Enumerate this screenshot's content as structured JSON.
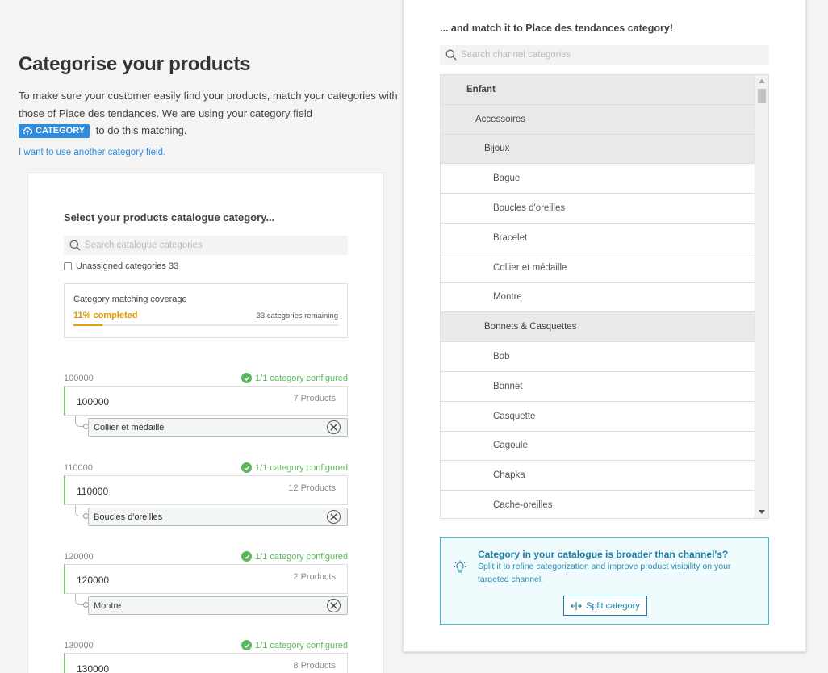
{
  "intro": {
    "title": "Categorise your products",
    "desc1": "To make sure your customer easily find your products, match your categories with those of Place des tendances. We are using your category field",
    "badge": "CATEGORY",
    "desc2": "to do this matching.",
    "link": "I want to use another category field."
  },
  "left": {
    "heading": "Select your products catalogue category...",
    "search_placeholder": "Search catalogue categories",
    "unassigned_label": "Unassigned categories 33",
    "coverage": {
      "label": "Category matching coverage",
      "completed": "11% completed",
      "remaining": "33 categories remaining",
      "percent": 11
    },
    "groups": [
      {
        "code": "100000",
        "status": "1/1 category configured",
        "name": "100000",
        "products": "7 Products",
        "match": "Collier et médaille"
      },
      {
        "code": "110000",
        "status": "1/1 category configured",
        "name": "110000",
        "products": "12 Products",
        "match": "Boucles d'oreilles"
      },
      {
        "code": "120000",
        "status": "1/1 category configured",
        "name": "120000",
        "products": "2 Products",
        "match": "Montre"
      },
      {
        "code": "130000",
        "status": "1/1 category configured",
        "name": "130000",
        "products": "8 Products",
        "match": ""
      }
    ]
  },
  "right": {
    "heading": "... and match it to Place des tendances category!",
    "search_placeholder": "Search channel categories",
    "tree": [
      {
        "label": "Enfant",
        "level": 0
      },
      {
        "label": "Accessoires",
        "level": 1
      },
      {
        "label": "Bijoux",
        "level": 2
      },
      {
        "label": "Bague",
        "level": 3
      },
      {
        "label": "Boucles d'oreilles",
        "level": 3
      },
      {
        "label": "Bracelet",
        "level": 3
      },
      {
        "label": "Collier et médaille",
        "level": 3
      },
      {
        "label": "Montre",
        "level": 3
      },
      {
        "label": "Bonnets & Casquettes",
        "level": 2
      },
      {
        "label": "Bob",
        "level": 3
      },
      {
        "label": "Bonnet",
        "level": 3
      },
      {
        "label": "Casquette",
        "level": 3
      },
      {
        "label": "Cagoule",
        "level": 3
      },
      {
        "label": "Chapka",
        "level": 3
      },
      {
        "label": "Cache-oreilles",
        "level": 3
      }
    ],
    "broader": {
      "title": "Category in your catalogue is broader than channel's?",
      "desc": "Split it to refine categorization and improve product visibility on your targeted channel.",
      "button": "Split category"
    }
  }
}
